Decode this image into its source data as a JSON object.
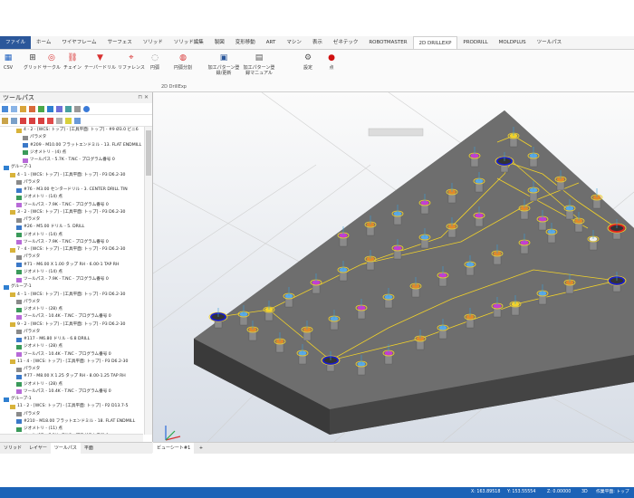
{
  "ribbon": {
    "tabs": [
      "ファイル",
      "ホーム",
      "ワイヤフレーム",
      "サーフェス",
      "ソリッド",
      "ソリッド編集",
      "製図",
      "変形移動",
      "ART",
      "マシン",
      "表示",
      "ゼネテック",
      "ROBOTMASTER",
      "2D DRILLEXP",
      "PRODRILL",
      "MOLDPLUS",
      "ツールパス"
    ],
    "active_tab_index": 13,
    "buttons": [
      {
        "label": "CSV",
        "icon": "csv-icon"
      },
      {
        "label": "グリッド",
        "icon": "grid-icon"
      },
      {
        "label": "サークル",
        "icon": "circle-icon"
      },
      {
        "label": "チェイン",
        "icon": "chain-icon"
      },
      {
        "label": "テーパードリル",
        "icon": "taper-drill-icon"
      },
      {
        "label": "リファレンス",
        "icon": "reference-icon"
      },
      {
        "label": "円弧",
        "icon": "arc-icon"
      },
      {
        "label": "円弧分割",
        "icon": "arc-split-icon"
      },
      {
        "label": "加工パターン登録/更新",
        "icon": "save-icon"
      },
      {
        "label": "加工パターン登録マニュアル",
        "icon": "manual-icon"
      },
      {
        "label": "設定",
        "icon": "settings-icon"
      },
      {
        "label": "点",
        "icon": "point-icon"
      }
    ],
    "group_label": "2D DrillExp"
  },
  "panel": {
    "title": "ツールパス",
    "close": "✕",
    "pin": "⊓",
    "tree": [
      {
        "indent": 2,
        "kind": "op",
        "text": "4 - 2 - [WCS: トップ] - [工具平面: トップ] - #9 Ø3.0 ビニ6"
      },
      {
        "indent": 3,
        "kind": "param",
        "text": "パラメタ"
      },
      {
        "indent": 3,
        "kind": "tool",
        "text": "#209 - M10.00 フラットエンドミル - 13. FLAT ENDMILL"
      },
      {
        "indent": 3,
        "kind": "geo",
        "text": "ジオメトリ - (4) 点"
      },
      {
        "indent": 3,
        "kind": "path",
        "text": "ツールパス - 5.7K - T.NC - プログラム番号 0"
      },
      {
        "indent": 0,
        "kind": "group",
        "text": "グループ-1"
      },
      {
        "indent": 1,
        "kind": "op",
        "text": "4 - 1 - [WCS: トップ] - [工具平面: トップ] - P3 D6.2-30"
      },
      {
        "indent": 2,
        "kind": "param",
        "text": "パラメタ"
      },
      {
        "indent": 2,
        "kind": "tool",
        "text": "#76 - M3.00 センタードリル - 3. CENTER DRILL TIN"
      },
      {
        "indent": 2,
        "kind": "geo",
        "text": "ジオメトリ - (14) 点"
      },
      {
        "indent": 2,
        "kind": "path",
        "text": "ツールパス - 7.9K - T.NC - プログラム番号 0"
      },
      {
        "indent": 1,
        "kind": "op",
        "text": "3 - 2 - [WCS: トップ] - [工具平面: トップ] - P3 D6.2-30"
      },
      {
        "indent": 2,
        "kind": "param",
        "text": "パラメタ"
      },
      {
        "indent": 2,
        "kind": "tool",
        "text": "#26 - M5.00 ドリル - 5. DRILL"
      },
      {
        "indent": 2,
        "kind": "geo",
        "text": "ジオメトリ - (14) 点"
      },
      {
        "indent": 2,
        "kind": "path",
        "text": "ツールパス - 7.9K - T.NC - プログラム番号 0"
      },
      {
        "indent": 1,
        "kind": "op",
        "text": "7 - 4 - [WCS: トップ] - [工具平面: トップ] - P3 D6.2-30"
      },
      {
        "indent": 2,
        "kind": "param",
        "text": "パラメタ"
      },
      {
        "indent": 2,
        "kind": "tool",
        "text": "#71 - M6.00 X 1.00 タップ RH - 6.00-1 TAP RH"
      },
      {
        "indent": 2,
        "kind": "geo",
        "text": "ジオメトリ - (14) 点"
      },
      {
        "indent": 2,
        "kind": "path",
        "text": "ツールパス - 7.9K - T.NC - プログラム番号 0"
      },
      {
        "indent": 0,
        "kind": "group",
        "text": "グループ-1"
      },
      {
        "indent": 1,
        "kind": "op",
        "text": "4 - 1 - [WCS: トップ] - [工具平面: トップ] - P3 D6.2-30"
      },
      {
        "indent": 2,
        "kind": "param",
        "text": "パラメタ"
      },
      {
        "indent": 2,
        "kind": "geo",
        "text": "ジオメトリ - (28) 点"
      },
      {
        "indent": 2,
        "kind": "path",
        "text": "ツールパス - 10.4K - T.NC - プログラム番号 0"
      },
      {
        "indent": 1,
        "kind": "op",
        "text": "9 - 2 - [WCS: トップ] - [工具平面: トップ] - P3 D6.2-30"
      },
      {
        "indent": 2,
        "kind": "param",
        "text": "パラメタ"
      },
      {
        "indent": 2,
        "kind": "tool",
        "text": "#117 - M6.80 ドリル - 6.8 DRILL"
      },
      {
        "indent": 2,
        "kind": "geo",
        "text": "ジオメトリ - (28) 点"
      },
      {
        "indent": 2,
        "kind": "path",
        "text": "ツールパス - 10.4K - T.NC - プログラム番号 0"
      },
      {
        "indent": 1,
        "kind": "op",
        "text": "11 - 4 - [WCS: トップ] - [工具平面: トップ] - P3 D6.2-30"
      },
      {
        "indent": 2,
        "kind": "param",
        "text": "パラメタ"
      },
      {
        "indent": 2,
        "kind": "tool",
        "text": "#77 - M8.00 X 1.25 タップ RH - 8.00-1.25 TAP RH"
      },
      {
        "indent": 2,
        "kind": "geo",
        "text": "ジオメトリ - (28) 点"
      },
      {
        "indent": 2,
        "kind": "path",
        "text": "ツールパス - 10.4K - T.NC - プログラム番号 0"
      },
      {
        "indent": 0,
        "kind": "group",
        "text": "グループ-1"
      },
      {
        "indent": 1,
        "kind": "op",
        "text": "11 - 2 - [WCS: トップ] - [工具平面: トップ] - P2 D13.7-5"
      },
      {
        "indent": 2,
        "kind": "param",
        "text": "パラメタ"
      },
      {
        "indent": 2,
        "kind": "tool",
        "text": "#210 - M18.00 フラットエンドミル - 18. FLAT ENDMILL"
      },
      {
        "indent": 2,
        "kind": "geo",
        "text": "ジオメトリ - (11) 点"
      },
      {
        "indent": 2,
        "kind": "path",
        "text": "ツールパス - 7.2K - T.NC - プログラム番号 0"
      }
    ],
    "bottom_tabs": [
      "ソリッド",
      "レイヤー",
      "ツールパス",
      "平面"
    ],
    "active_bottom_tab": 2
  },
  "viewport": {
    "sheet_tab": "ビューシート#1",
    "add_sheet": "+",
    "colors": {
      "plate": "#6b6b6b",
      "rim": "#f2d22a",
      "taper": "#c83bd0",
      "tap": "#5aa9e6",
      "drill": "#e08a2a",
      "big": "#1a1ec8",
      "red": "#e02020"
    }
  },
  "statusbar": {
    "x": "X: 163.89518",
    "y": "Y: 153.55554",
    "z": "Z: 0.00000",
    "mode": "3D",
    "plane": "作業平面: トップ"
  }
}
